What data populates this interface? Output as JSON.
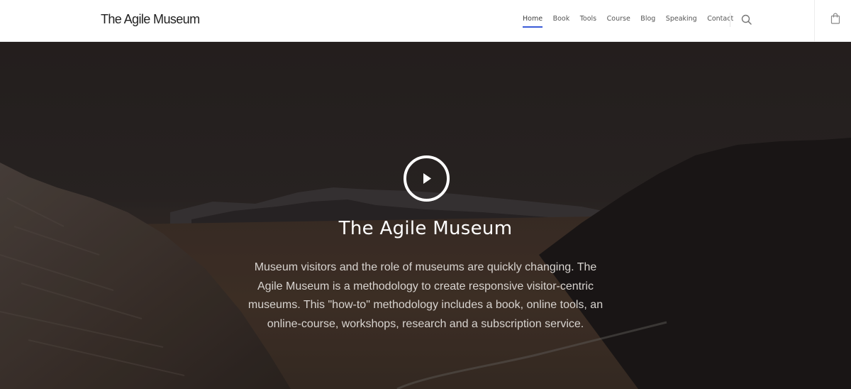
{
  "header": {
    "logo": "The Agile Museum",
    "nav": [
      {
        "label": "Home",
        "active": true
      },
      {
        "label": "Book",
        "active": false
      },
      {
        "label": "Tools",
        "active": false
      },
      {
        "label": "Course",
        "active": false
      },
      {
        "label": "Blog",
        "active": false
      },
      {
        "label": "Speaking",
        "active": false
      },
      {
        "label": "Contact",
        "active": false
      }
    ],
    "search_icon": "search-icon",
    "cart_icon": "shopping-bag-icon",
    "accent_color": "#3a5bd8"
  },
  "hero": {
    "play_icon": "play-icon",
    "title": "The Agile Museum",
    "description": "Museum visitors and the role of museums are quickly changing. The Agile Museum is a methodology to create responsive visitor-centric museums. This \"how-to\" methodology includes a book, online tools, an online-course, workshops, research and a subscription service."
  }
}
